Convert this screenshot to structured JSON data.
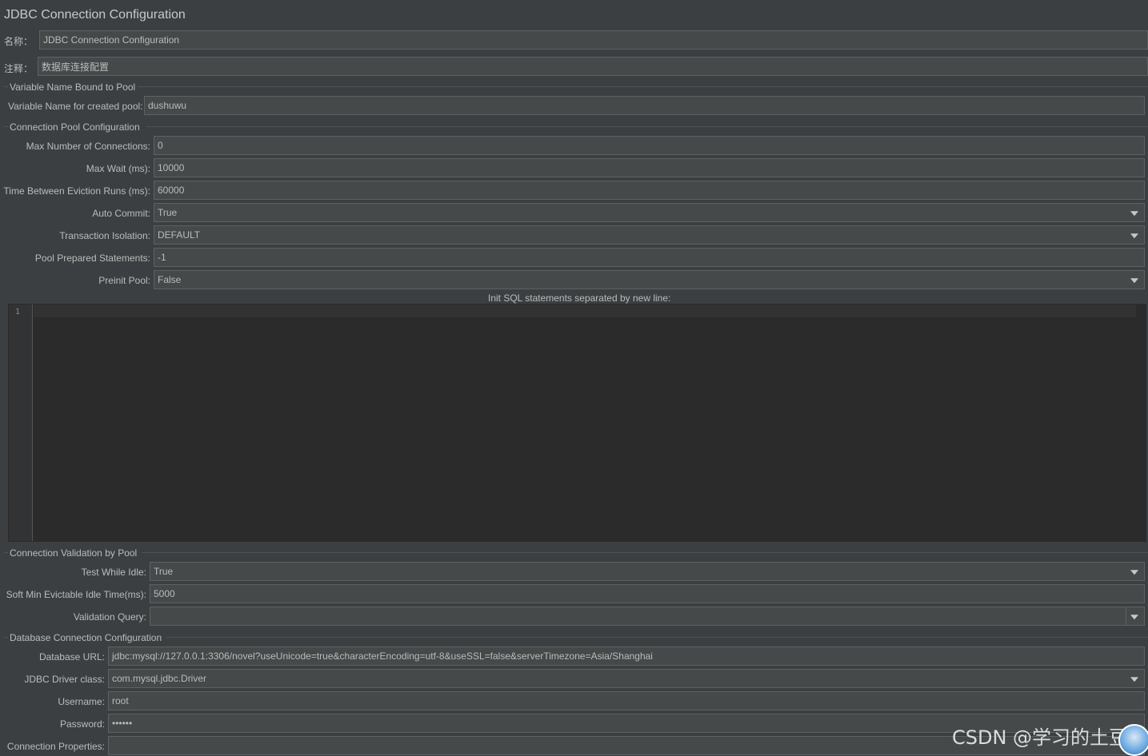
{
  "title": "JDBC Connection Configuration",
  "name_label": "名称：",
  "name_value": "JDBC Connection Configuration",
  "comment_label": "注释：",
  "comment_value": "数据库连接配置",
  "pool_var_group": {
    "title": "Variable Name Bound to Pool",
    "var_label": "Variable Name for created pool:",
    "var_value": "dushuwu"
  },
  "pool_config_group": {
    "title": "Connection Pool Configuration",
    "max_conn_label": "Max Number of Connections:",
    "max_conn_value": "0",
    "max_wait_label": "Max Wait (ms):",
    "max_wait_value": "10000",
    "eviction_label": "Time Between Eviction Runs (ms):",
    "eviction_value": "60000",
    "auto_commit_label": "Auto Commit:",
    "auto_commit_value": "True",
    "isolation_label": "Transaction Isolation:",
    "isolation_value": "DEFAULT",
    "prepared_label": "Pool Prepared Statements:",
    "prepared_value": "-1",
    "preinit_label": "Preinit Pool:",
    "preinit_value": "False",
    "init_sql_label": "Init SQL statements separated by new line:",
    "init_sql_line_number": "1"
  },
  "validation_group": {
    "title": "Connection Validation by Pool",
    "test_idle_label": "Test While Idle:",
    "test_idle_value": "True",
    "soft_min_label": "Soft Min Evictable Idle Time(ms):",
    "soft_min_value": "5000",
    "validation_query_label": "Validation Query:",
    "validation_query_value": ""
  },
  "db_group": {
    "title": "Database Connection Configuration",
    "url_label": "Database URL:",
    "url_value": "jdbc:mysql://127.0.0.1:3306/novel?useUnicode=true&characterEncoding=utf-8&useSSL=false&serverTimezone=Asia/Shanghai",
    "driver_label": "JDBC Driver class:",
    "driver_value": "com.mysql.jdbc.Driver",
    "username_label": "Username:",
    "username_value": "root",
    "password_label": "Password:",
    "password_value": "••••••",
    "props_label": "Connection Properties:",
    "props_value": ""
  },
  "watermark": "CSDN @学习的土豆",
  "icons": {
    "combo_arrow": "chevron-down-icon",
    "avatar": "avatar-icon"
  },
  "colors": {
    "background": "#3c3f41",
    "field": "#45494a",
    "editor": "#2b2b2b",
    "text": "#bbbbbb"
  }
}
